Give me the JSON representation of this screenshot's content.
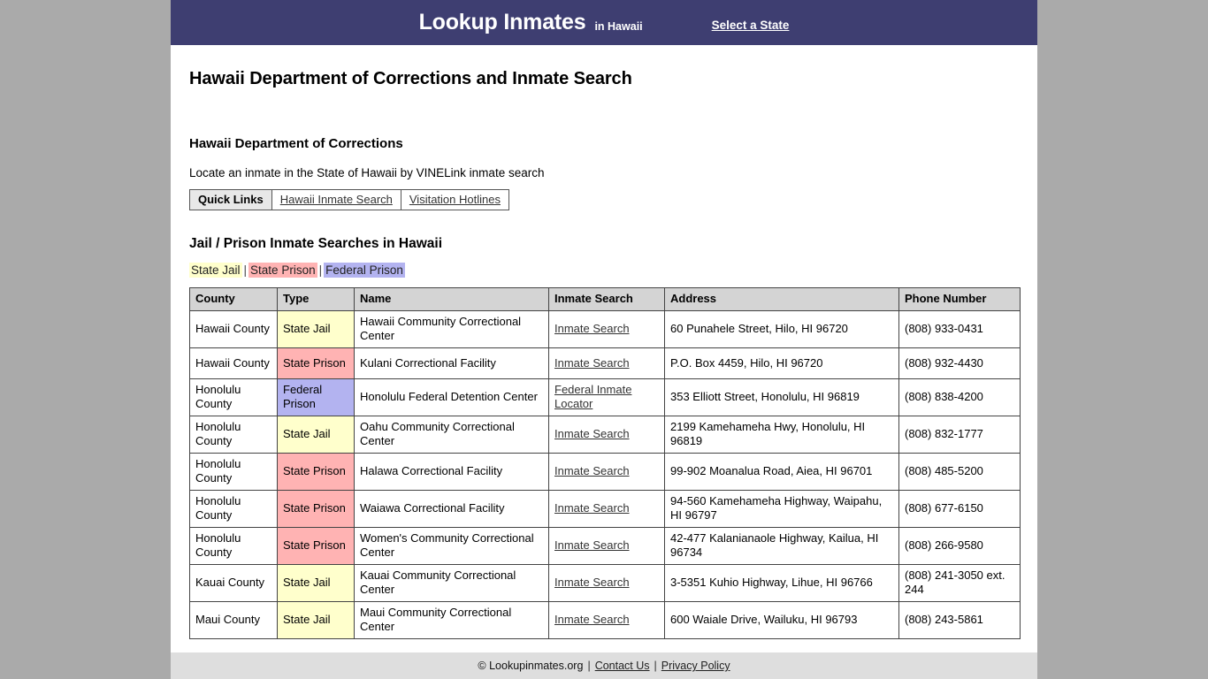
{
  "header": {
    "brand": "Lookup Inmates",
    "brand_sub": "in Hawaii",
    "select_state": "Select a State",
    "bg_color": "#3e3e71"
  },
  "page_title": "Hawaii Department of Corrections and Inmate Search",
  "section": {
    "title": "Hawaii Department of Corrections",
    "description": "Locate an inmate in the State of Hawaii by VINELink inmate search"
  },
  "quick_links": {
    "label": "Quick Links",
    "items": [
      {
        "label": "Hawaii Inmate Search"
      },
      {
        "label": "Visitation Hotlines"
      }
    ]
  },
  "table_section": {
    "title": "Jail / Prison Inmate Searches in Hawaii",
    "legend": [
      {
        "label": "State Jail",
        "color": "#ffffcc"
      },
      {
        "label": "State Prison",
        "color": "#ffb3b3"
      },
      {
        "label": "Federal Prison",
        "color": "#b3b3f0"
      }
    ],
    "legend_separator": "|",
    "columns": [
      "County",
      "Type",
      "Name",
      "Inmate Search",
      "Address",
      "Phone Number"
    ],
    "rows": [
      {
        "county": "Hawaii County",
        "type": "State Jail",
        "type_class": "sw-jail",
        "name": "Hawaii Community Correctional Center",
        "search": "Inmate Search",
        "address": "60 Punahele Street, Hilo, HI 96720",
        "phone": "(808) 933-0431"
      },
      {
        "county": "Hawaii County",
        "type": "State Prison",
        "type_class": "sw-state",
        "name": "Kulani Correctional Facility",
        "search": "Inmate Search",
        "address": "P.O. Box 4459, Hilo, HI 96720",
        "phone": "(808) 932-4430"
      },
      {
        "county": "Honolulu County",
        "type": "Federal Prison",
        "type_class": "sw-fed",
        "name": "Honolulu Federal Detention Center",
        "search": "Federal Inmate Locator",
        "address": "353 Elliott Street, Honolulu, HI 96819",
        "phone": "(808) 838-4200"
      },
      {
        "county": "Honolulu County",
        "type": "State Jail",
        "type_class": "sw-jail",
        "name": "Oahu Community Correctional Center",
        "search": "Inmate Search",
        "address": "2199 Kamehameha Hwy, Honolulu, HI 96819",
        "phone": "(808) 832-1777"
      },
      {
        "county": "Honolulu County",
        "type": "State Prison",
        "type_class": "sw-state",
        "name": "Halawa Correctional Facility",
        "search": "Inmate Search",
        "address": "99-902 Moanalua Road, Aiea, HI 96701",
        "phone": "(808) 485-5200"
      },
      {
        "county": "Honolulu County",
        "type": "State Prison",
        "type_class": "sw-state",
        "name": "Waiawa Correctional Facility",
        "search": "Inmate Search",
        "address": "94-560 Kamehameha Highway, Waipahu, HI 96797",
        "phone": "(808) 677-6150"
      },
      {
        "county": "Honolulu County",
        "type": "State Prison",
        "type_class": "sw-state",
        "name": "Women's Community Correctional Center",
        "search": "Inmate Search",
        "address": "42-477 Kalanianaole Highway, Kailua, HI 96734",
        "phone": "(808) 266-9580"
      },
      {
        "county": "Kauai County",
        "type": "State Jail",
        "type_class": "sw-jail",
        "name": "Kauai Community Correctional Center",
        "search": "Inmate Search",
        "address": "3-5351 Kuhio Highway, Lihue, HI 96766",
        "phone": "(808) 241-3050 ext. 244"
      },
      {
        "county": "Maui County",
        "type": "State Jail",
        "type_class": "sw-jail",
        "name": "Maui Community Correctional Center",
        "search": "Inmate Search",
        "address": "600 Waiale Drive, Wailuku, HI 96793",
        "phone": "(808) 243-5861"
      }
    ]
  },
  "footer": {
    "copyright": "© Lookupinmates.org",
    "sep": "|",
    "contact": "Contact Us",
    "privacy": "Privacy Policy"
  }
}
